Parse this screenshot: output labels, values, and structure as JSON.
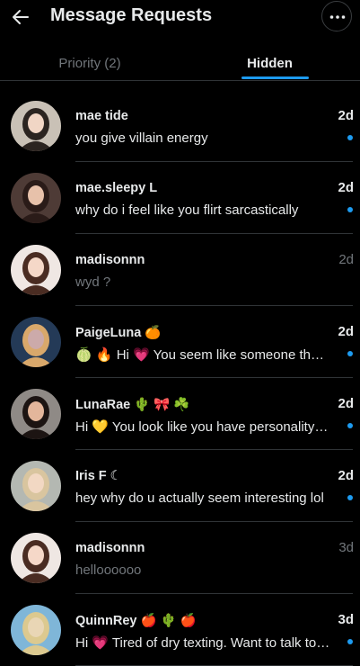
{
  "header": {
    "title": "Message Requests",
    "back_icon": "arrow-left-icon",
    "more_icon": "more-horizontal-icon"
  },
  "tabs": [
    {
      "label": "Priority (2)",
      "active": false
    },
    {
      "label": "Hidden",
      "active": true
    }
  ],
  "colors": {
    "background": "#000000",
    "accent": "#1d9bf0",
    "text_primary": "#e7e9ea",
    "text_secondary": "#71767b",
    "divider": "#2f3336"
  },
  "conversations": [
    {
      "name": "mae tide",
      "time": "2d",
      "preview": "you give villain energy",
      "unread": true,
      "avatar": "profile-photo"
    },
    {
      "name": "mae.sleepy L",
      "time": "2d",
      "preview": "why do i feel like you flirt sarcastically",
      "unread": true,
      "avatar": "profile-photo"
    },
    {
      "name": "madisonnn",
      "time": "2d",
      "preview": "wyd ?",
      "unread": false,
      "avatar": "profile-photo"
    },
    {
      "name": "PaigeLuna 🍊",
      "time": "2d",
      "preview": "🍈 🔥 Hi 💗 You seem like someone that’s actually fun to talk to",
      "unread": true,
      "avatar": "profile-photo"
    },
    {
      "name": "LunaRae 🌵 🎀 ☘️",
      "time": "2d",
      "preview": "Hi 💛 You look like you have personality and I like that",
      "unread": true,
      "avatar": "profile-photo"
    },
    {
      "name": "Iris F ☾",
      "time": "2d",
      "preview": "hey why do u actually seem interesting lol",
      "unread": true,
      "avatar": "profile-photo"
    },
    {
      "name": "madisonnn",
      "time": "3d",
      "preview": "helloooooo",
      "unread": false,
      "avatar": "profile-photo"
    },
    {
      "name": "QuinnRey 🍎 🌵 🍎",
      "time": "3d",
      "preview": "Hi 💗 Tired of dry texting. Want to talk to someone real?",
      "unread": true,
      "avatar": "profile-photo"
    }
  ]
}
